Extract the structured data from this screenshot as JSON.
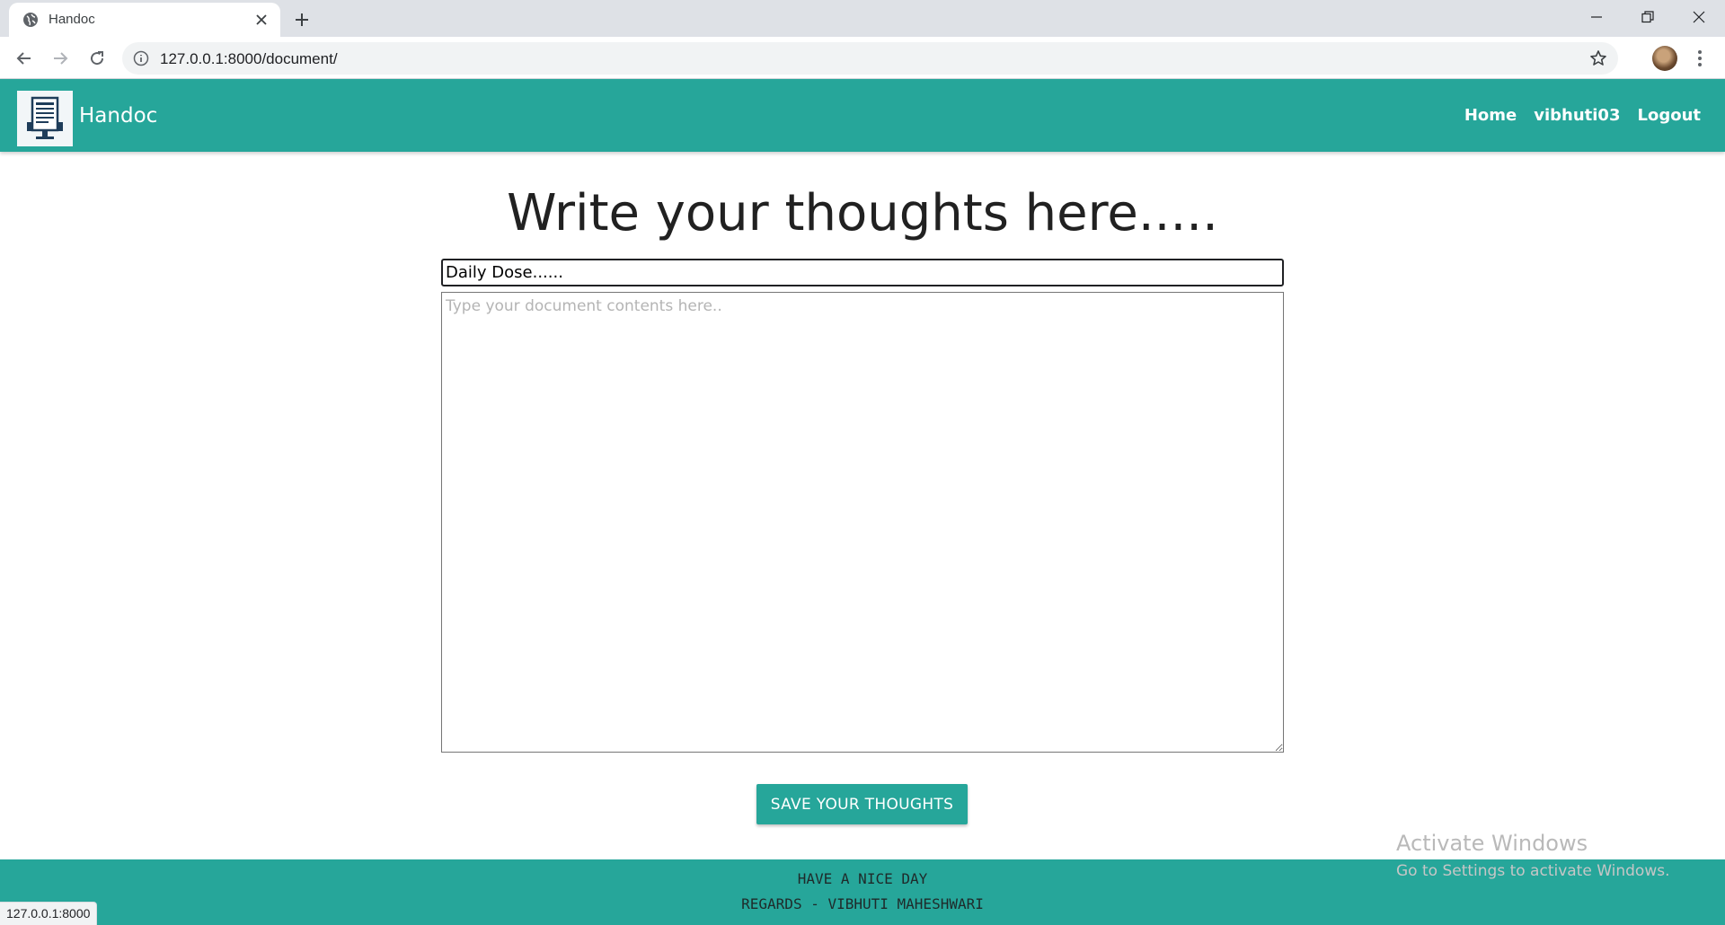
{
  "browser": {
    "tab_title": "Handoc",
    "url": "127.0.0.1:8000/document/",
    "status_url": "127.0.0.1:8000"
  },
  "navbar": {
    "brand": "Handoc",
    "links": [
      "Home",
      "vibhuti03",
      "Logout"
    ]
  },
  "main": {
    "heading": "Write your thoughts here.....",
    "title_value": "Daily Dose......",
    "content_placeholder": "Type your document contents here..",
    "save_label": "SAVE YOUR THOUGHTS"
  },
  "watermark": {
    "title": "Activate Windows",
    "subtitle": "Go to Settings to activate Windows."
  },
  "footer": {
    "line1": "HAVE A NICE DAY",
    "line2": "REGARDS - VIBHUTI MAHESHWARI"
  },
  "colors": {
    "accent": "#26a69a",
    "text_dark": "#212121"
  }
}
